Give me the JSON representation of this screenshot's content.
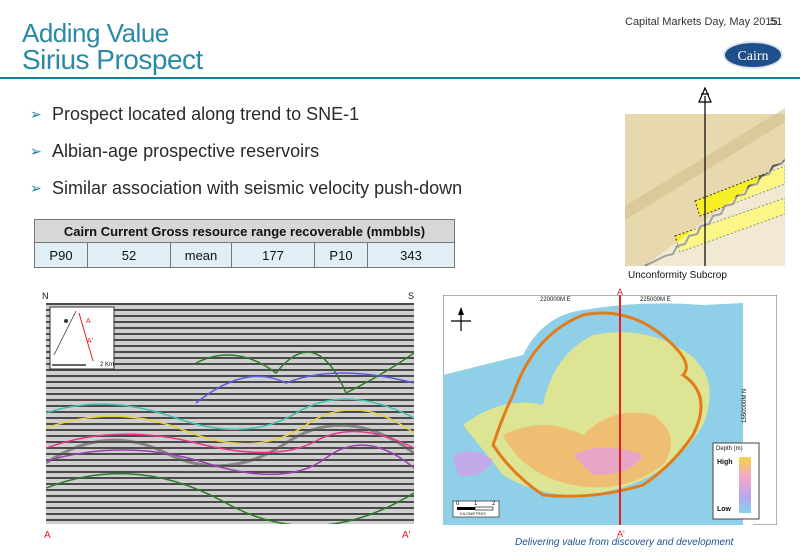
{
  "header": {
    "title_line1": "Adding Value",
    "title_line2": "Sirius Prospect",
    "event": "Capital Markets Day, May 2015",
    "page_number": "51",
    "logo_text": "Cairn"
  },
  "bullets": [
    "Prospect located along trend to SNE-1",
    "Albian-age prospective reservoirs",
    "Similar association with seismic velocity push-down"
  ],
  "resource_table": {
    "heading": "Cairn Current Gross resource range recoverable (mmbbls)",
    "cells": [
      "P90",
      "52",
      "mean",
      "177",
      "P10",
      "343"
    ]
  },
  "diagram": {
    "caption": "Unconformity Subcrop"
  },
  "seismic": {
    "label_left_top": "N",
    "label_right_top": "S",
    "label_left_bottom": "A",
    "label_right_bottom": "A'",
    "inset_a": "A",
    "inset_a_prime": "A'",
    "inset_scale": "2 Km"
  },
  "map": {
    "label_top": "A",
    "label_bottom": "A'",
    "coord_1": "220000M E",
    "coord_2": "225000M E",
    "coord_side": "1550000M N",
    "legend_title": "Depth (m)",
    "legend_high": "High",
    "legend_low": "Low",
    "scale_ticks": [
      "0",
      "1",
      "2"
    ],
    "scale_units": "KILOMETRES"
  },
  "footer": {
    "tagline": "Delivering value from discovery and development"
  },
  "colors": {
    "title": "#2a8aa6",
    "accent_line": "#1a7f99",
    "section_line": "#e41e25",
    "prospect_outline": "#e07d1a"
  }
}
